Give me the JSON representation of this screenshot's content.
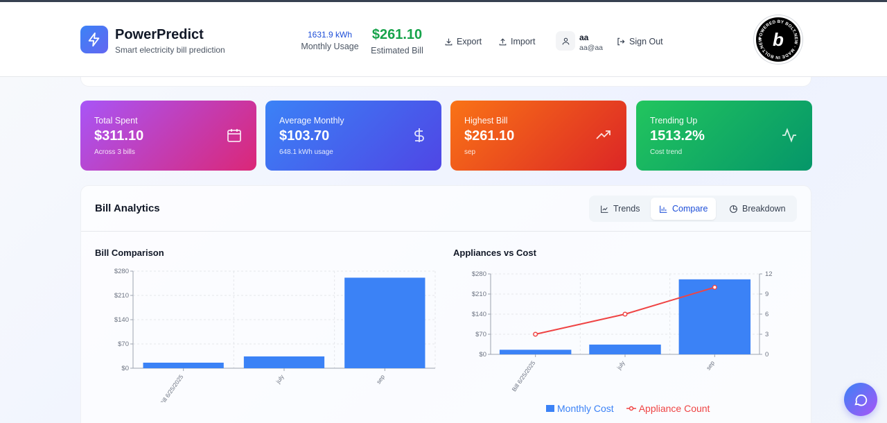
{
  "app": {
    "title": "PowerPredict",
    "subtitle": "Smart electricity bill prediction"
  },
  "header_stats": {
    "usage_value": "1631.9 kWh",
    "usage_label": "Monthly Usage",
    "bill_value": "$261.10",
    "bill_label": "Estimated Bill"
  },
  "header_actions": {
    "export": "Export",
    "import": "Import",
    "sign_out": "Sign Out"
  },
  "user": {
    "name": "aa",
    "email": "aa@aa"
  },
  "badge_text": "POWERED BY BOLT.NEW · MADE IN BOLT.NEW ·",
  "stats": [
    {
      "title": "Total Spent",
      "value": "$311.10",
      "sub": "Across 3 bills",
      "icon": "calendar-icon"
    },
    {
      "title": "Average Monthly",
      "value": "$103.70",
      "sub": "648.1 kWh usage",
      "icon": "dollar-icon"
    },
    {
      "title": "Highest Bill",
      "value": "$261.10",
      "sub": "sep",
      "icon": "trending-up-icon"
    },
    {
      "title": "Trending Up",
      "value": "1513.2%",
      "sub": "Cost trend",
      "icon": "activity-icon"
    }
  ],
  "analytics": {
    "title": "Bill Analytics",
    "tabs": [
      {
        "label": "Trends",
        "active": false
      },
      {
        "label": "Compare",
        "active": true
      },
      {
        "label": "Breakdown",
        "active": false
      }
    ]
  },
  "chart_data": [
    {
      "type": "bar",
      "title": "Bill Comparison",
      "categories": [
        "Bill 6/25/2025",
        "july",
        "sep"
      ],
      "series": [
        {
          "values": [
            16,
            34,
            261.1
          ]
        }
      ],
      "y_ticks": [
        "$0",
        "$70",
        "$140",
        "$210",
        "$280"
      ],
      "ylim": [
        0,
        280
      ],
      "grid": true,
      "color": "#3b82f6"
    },
    {
      "type": "bar",
      "title": "Appliances vs Cost",
      "categories": [
        "Bill 6/25/2025",
        "july",
        "sep"
      ],
      "series": [
        {
          "name": "Monthly Cost",
          "type": "bar",
          "axis": "left",
          "values": [
            16,
            34,
            261.1
          ],
          "color": "#3b82f6"
        },
        {
          "name": "Appliance Count",
          "type": "line",
          "axis": "right",
          "values": [
            3,
            6,
            10
          ],
          "color": "#ef4444"
        }
      ],
      "y_ticks": [
        "$0",
        "$70",
        "$140",
        "$210",
        "$280"
      ],
      "y2_ticks": [
        "0",
        "3",
        "6",
        "9",
        "12"
      ],
      "ylim": [
        0,
        280
      ],
      "y2lim": [
        0,
        12
      ],
      "grid": true,
      "legend_position": "bottom"
    }
  ]
}
